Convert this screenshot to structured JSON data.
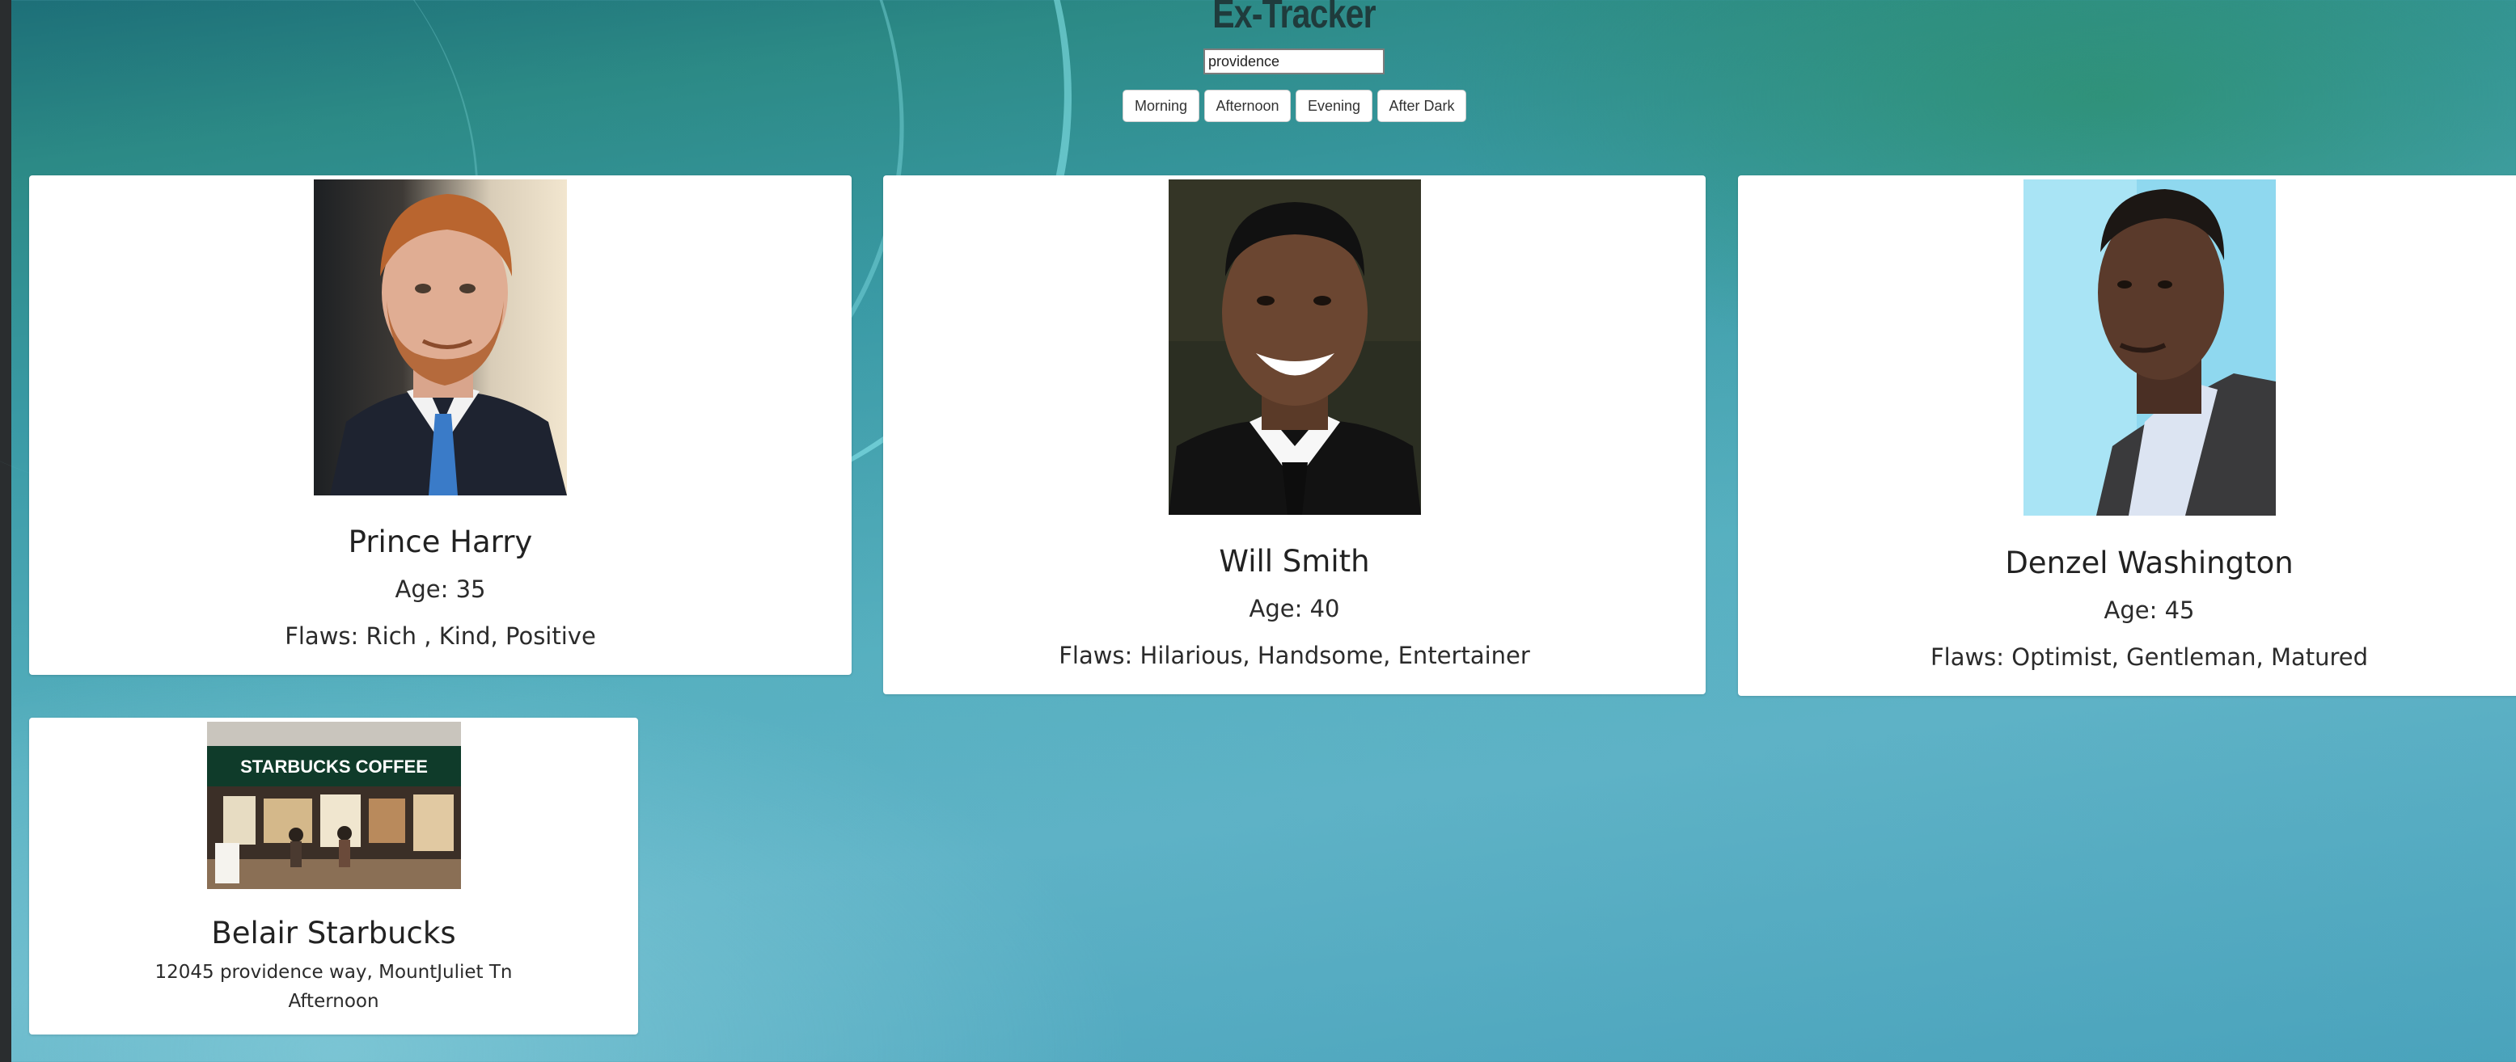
{
  "app": {
    "title": "Ex-Tracker"
  },
  "search": {
    "value": "providence"
  },
  "time_filters": [
    "Morning",
    "Afternoon",
    "Evening",
    "After Dark"
  ],
  "cards": [
    {
      "name": "Prince Harry",
      "age": "Age: 35",
      "flaws": "Flaws: Rich , Kind, Positive"
    },
    {
      "name": "Will Smith",
      "age": "Age: 40",
      "flaws": "Flaws: Hilarious, Handsome, Entertainer"
    },
    {
      "name": "Denzel Washington",
      "age": "Age: 45",
      "flaws": "Flaws: Optimist, Gentleman, Matured"
    }
  ],
  "location_card": {
    "name": "Belair Starbucks",
    "address": "12045 providence way, MountJuliet Tn",
    "time": "Afternoon",
    "sign_text": "STARBUCKS COFFEE"
  },
  "colors": {
    "background_top": "#1d6f78",
    "background_bottom": "#5eb2c6",
    "card": "#ffffff",
    "title": "#1f3b3c"
  }
}
